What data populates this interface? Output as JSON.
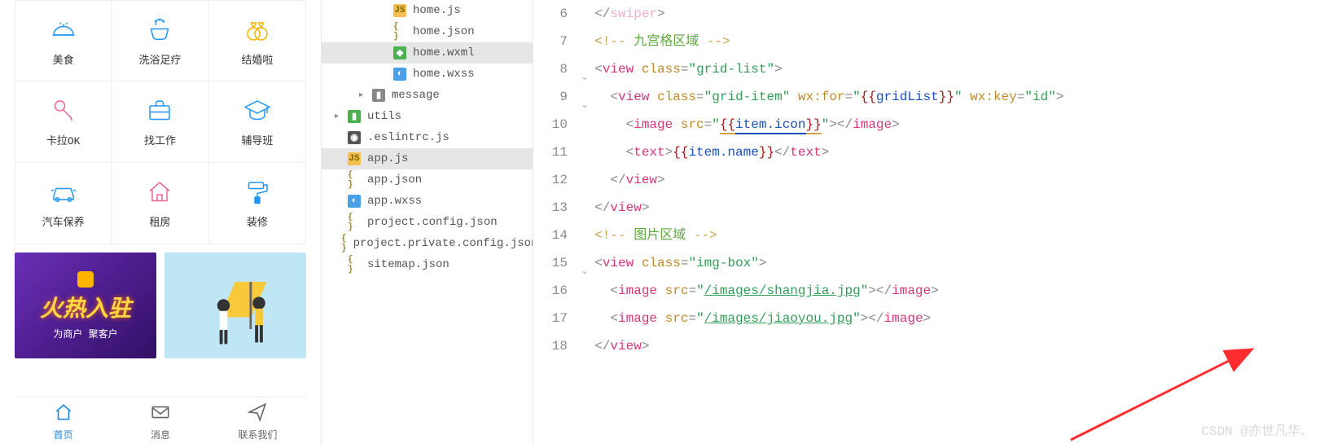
{
  "phone": {
    "grid": [
      {
        "label": "美食",
        "svg": "food"
      },
      {
        "label": "洗浴足疗",
        "svg": "shower"
      },
      {
        "label": "结婚啦",
        "svg": "rings"
      },
      {
        "label": "卡拉OK",
        "svg": "mic"
      },
      {
        "label": "找工作",
        "svg": "briefcase"
      },
      {
        "label": "辅导班",
        "svg": "gradcap"
      },
      {
        "label": "汽车保养",
        "svg": "car"
      },
      {
        "label": "租房",
        "svg": "house"
      },
      {
        "label": "装修",
        "svg": "roller"
      }
    ],
    "banner1": {
      "main": "火热入驻",
      "sub": "为商户 聚客户"
    },
    "tabs": [
      {
        "label": "首页",
        "icon": "home",
        "active": true
      },
      {
        "label": "消息",
        "icon": "mail",
        "active": false
      },
      {
        "label": "联系我们",
        "icon": "send",
        "active": false
      }
    ]
  },
  "tree": [
    {
      "depth": 2,
      "twisty": "",
      "icon": "js",
      "label": "home.js",
      "sel": false
    },
    {
      "depth": 2,
      "twisty": "",
      "icon": "json",
      "label": "home.json",
      "sel": false
    },
    {
      "depth": 2,
      "twisty": "",
      "icon": "wxml",
      "label": "home.wxml",
      "sel": true
    },
    {
      "depth": 2,
      "twisty": "",
      "icon": "wxss",
      "label": "home.wxss",
      "sel": false
    },
    {
      "depth": 1,
      "twisty": "▸",
      "icon": "folder",
      "label": "message",
      "sel": false
    },
    {
      "depth": 0,
      "twisty": "▸",
      "icon": "folderg",
      "label": "utils",
      "sel": false
    },
    {
      "depth": 0,
      "twisty": "",
      "icon": "dot",
      "label": ".eslintrc.js",
      "sel": false
    },
    {
      "depth": 0,
      "twisty": "",
      "icon": "js",
      "label": "app.js",
      "sel": true
    },
    {
      "depth": 0,
      "twisty": "",
      "icon": "json",
      "label": "app.json",
      "sel": false
    },
    {
      "depth": 0,
      "twisty": "",
      "icon": "wxss",
      "label": "app.wxss",
      "sel": false
    },
    {
      "depth": 0,
      "twisty": "",
      "icon": "json",
      "label": "project.config.json",
      "sel": false
    },
    {
      "depth": 0,
      "twisty": "",
      "icon": "json",
      "label": "project.private.config.json",
      "sel": false
    },
    {
      "depth": 0,
      "twisty": "",
      "icon": "json",
      "label": "sitemap.json",
      "sel": false
    }
  ],
  "code": {
    "lines": [
      7,
      8,
      9,
      10,
      11,
      12,
      13,
      14,
      15,
      16,
      17,
      18
    ],
    "folds": {
      "8": "v",
      "9": "v",
      "15": "v"
    },
    "l6": "</swiper>",
    "l7": {
      "a": "<!-- ",
      "b": "九宫格区域",
      "c": " -->"
    },
    "l8": {
      "tag": "view",
      "attr": "class",
      "val": "grid-list"
    },
    "l9": {
      "tag": "view",
      "attr1": "class",
      "val1": "grid-item",
      "attr2": "wx:for",
      "val2a": "{{",
      "val2b": "gridList",
      "val2c": "}}",
      "attr3": "wx:key",
      "val3": "id"
    },
    "l10": {
      "tag": "image",
      "attr": "src",
      "valA": "{{",
      "valB": "item.icon",
      "valC": "}}"
    },
    "l11": {
      "tag": "text",
      "midA": "{{",
      "midB": "item.name",
      "midC": "}}"
    },
    "l12": {
      "tag": "view"
    },
    "l13": {
      "tag": "view"
    },
    "l14": {
      "a": "<!-- ",
      "b": "图片区域",
      "c": " -->"
    },
    "l15": {
      "tag": "view",
      "attr": "class",
      "val": "img-box"
    },
    "l16": {
      "tag": "image",
      "attr": "src",
      "val": "/images/shangjia.jpg"
    },
    "l17": {
      "tag": "image",
      "attr": "src",
      "val": "/images/jiaoyou.jpg"
    },
    "l18": {
      "tag": "view"
    }
  },
  "watermark": "CSDN @亦世凡华、"
}
